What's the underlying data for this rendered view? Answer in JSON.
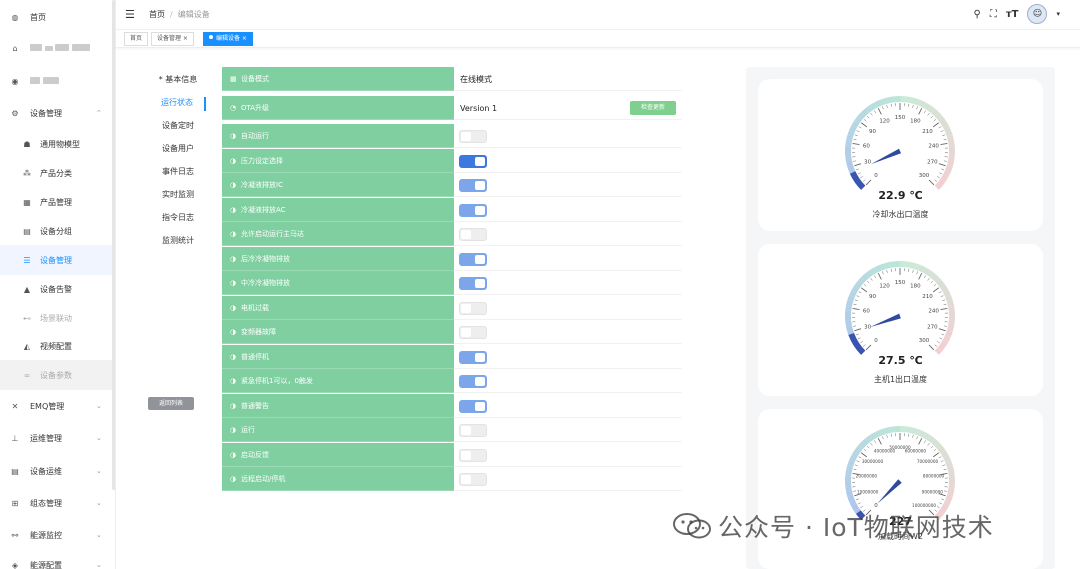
{
  "sidebar": {
    "items": [
      {
        "label": "首页",
        "icon": "dashboard-icon"
      },
      {
        "label": "",
        "icon": "home-icon",
        "blurred": true
      },
      {
        "label": "",
        "icon": "eye-icon",
        "blurred": true
      },
      {
        "label": "设备管理",
        "icon": "gear-icon",
        "expanded": true
      },
      {
        "label": "通用物模型",
        "icon": "model-icon"
      },
      {
        "label": "产品分类",
        "icon": "tree-icon"
      },
      {
        "label": "产品管理",
        "icon": "grid-icon"
      },
      {
        "label": "设备分组",
        "icon": "table-icon"
      },
      {
        "label": "设备管理",
        "icon": "list-icon",
        "active": true
      },
      {
        "label": "设备告警",
        "icon": "bell-icon"
      },
      {
        "label": "场景联动",
        "icon": "link-icon"
      },
      {
        "label": "视频配置",
        "icon": "video-icon"
      },
      {
        "label": "设备参数",
        "icon": "param-icon"
      },
      {
        "label": "EMQ管理",
        "icon": "x-icon"
      },
      {
        "label": "运维管理",
        "icon": "sitemap-icon"
      },
      {
        "label": "设备运维",
        "icon": "table-icon"
      },
      {
        "label": "组态管理",
        "icon": "layout-icon"
      },
      {
        "label": "能源监控",
        "icon": "energy-icon"
      },
      {
        "label": "能源配置",
        "icon": "config-icon"
      }
    ]
  },
  "header": {
    "breadcrumb": [
      "首页",
      "编辑设备"
    ]
  },
  "tabs": [
    "首页",
    "设备管理",
    "编辑设备"
  ],
  "leftnav": {
    "items": [
      "基本信息",
      "运行状态",
      "设备定时",
      "设备用户",
      "事件日志",
      "实时监测",
      "指令日志",
      "监测统计"
    ],
    "back": "返回列表"
  },
  "table": {
    "mode_label": "设备模式",
    "mode_value": "在线模式",
    "ota_label": "OTA升级",
    "ota_value": "Version 1",
    "check_update": "检查更新",
    "switches": [
      {
        "label": "自动运行",
        "on": false
      },
      {
        "label": "压力设定选择",
        "on": true,
        "strong": true
      },
      {
        "label": "冷凝液排放IC",
        "on": true
      },
      {
        "label": "冷凝液排放AC",
        "on": true
      },
      {
        "label": "允许启动运行主马达",
        "on": false
      },
      {
        "label": "后冷冷凝物排放",
        "on": true
      },
      {
        "label": "中冷冷凝物排放",
        "on": true
      },
      {
        "label": "电机过载",
        "on": false
      },
      {
        "label": "变频器故障",
        "on": false
      },
      {
        "label": "普通停机",
        "on": true
      },
      {
        "label": "紧急停机1可以，0触发",
        "on": true
      },
      {
        "label": "普通警告",
        "on": true
      },
      {
        "label": "运行",
        "on": false
      },
      {
        "label": "启动反馈",
        "on": false
      },
      {
        "label": "远程启动/停机",
        "on": false
      }
    ]
  },
  "gauges": [
    {
      "value": 22.9,
      "display": "22.9 ℃",
      "name": "冷却水出口温度",
      "min": 0,
      "max": 300,
      "ticks": [
        "0",
        "30",
        "60",
        "90",
        "120",
        "150",
        "180",
        "210",
        "240",
        "270",
        "300"
      ]
    },
    {
      "value": 27.5,
      "display": "27.5 ℃",
      "name": "主机1出口温度",
      "min": 0,
      "max": 300,
      "ticks": [
        "0",
        "30",
        "60",
        "90",
        "120",
        "150",
        "180",
        "210",
        "240",
        "270",
        "300"
      ]
    },
    {
      "value": 227,
      "display": "227",
      "name": "加载时间W2",
      "min": 0,
      "max": 100000000,
      "ticks": [
        "0",
        "10000000",
        "20000000",
        "30000000",
        "40000000",
        "50000000",
        "60000000",
        "70000000",
        "80000000",
        "90000000",
        "100000000"
      ]
    }
  ],
  "watermark": "公众号 · IoT物联网技术"
}
